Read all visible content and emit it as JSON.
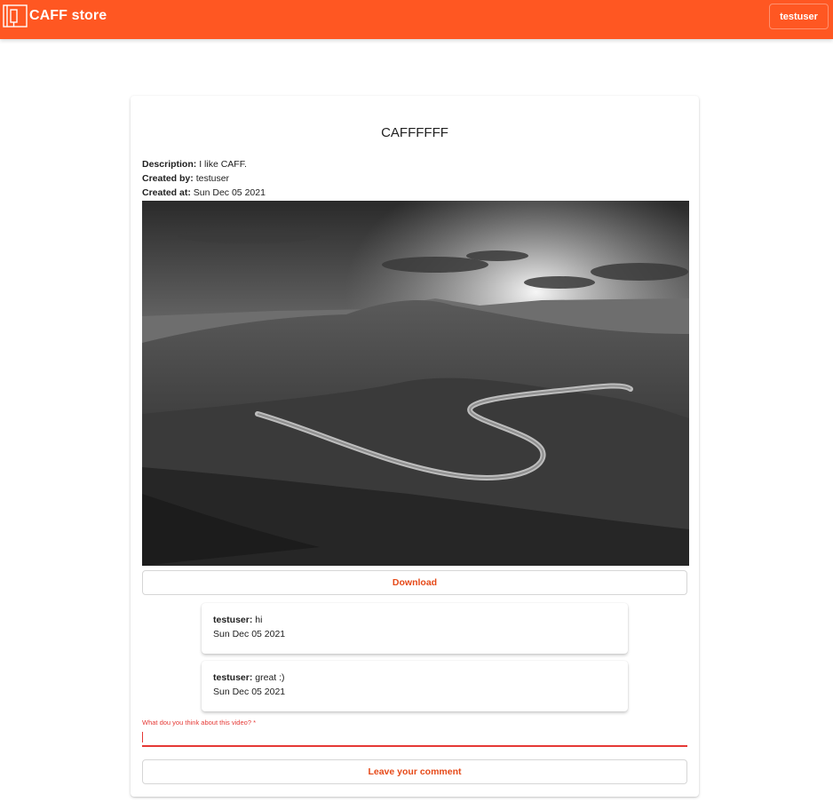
{
  "header": {
    "brand": "CAFF store",
    "user_button": "testuser",
    "logo_icon": "store-logo-icon",
    "background": "#ff5722"
  },
  "item": {
    "title": "CAFFFFFF",
    "description_label": "Description:",
    "description": "I like CAFF.",
    "created_by_label": "Created by:",
    "created_by": "testuser",
    "created_at_label": "Created at:",
    "created_at": "Sun Dec 05 2021",
    "image_alt": "Black and white landscape with winding road through hills"
  },
  "download_label": "Download",
  "comments": [
    {
      "author": "testuser:",
      "text": "hi",
      "date": "Sun Dec 05 2021"
    },
    {
      "author": "testuser:",
      "text": "great :)",
      "date": "Sun Dec 05 2021"
    }
  ],
  "comment_form": {
    "label": "What dou you think about this video? *",
    "value": "",
    "submit_label": "Leave your comment"
  },
  "colors": {
    "accent": "#ff5722",
    "button_text": "#e64a19",
    "error": "#e53935"
  }
}
